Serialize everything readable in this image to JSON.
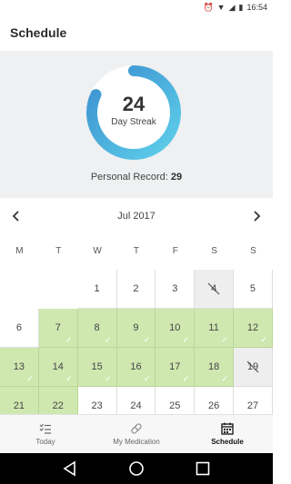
{
  "status": {
    "time": "16:54"
  },
  "app_bar": {
    "title": "Schedule"
  },
  "streak": {
    "value": "24",
    "label": "Day Streak",
    "ring_progress": 0.82,
    "record_label": "Personal Record:",
    "record_value": "29"
  },
  "calendar": {
    "month_label": "Jul 2017",
    "weekdays": [
      "M",
      "T",
      "W",
      "T",
      "F",
      "S",
      "S"
    ],
    "rows": [
      [
        {
          "day": "",
          "state": "empty"
        },
        {
          "day": "",
          "state": "empty"
        },
        {
          "day": "1",
          "state": "none"
        },
        {
          "day": "2",
          "state": "none"
        },
        {
          "day": "3",
          "state": "none"
        },
        {
          "day": "4",
          "state": "skipped"
        },
        {
          "day": "5",
          "state": "none"
        }
      ],
      [
        {
          "day": "6",
          "state": "none"
        },
        {
          "day": "7",
          "state": "done"
        },
        {
          "day": "8",
          "state": "done"
        },
        {
          "day": "9",
          "state": "done"
        },
        {
          "day": "10",
          "state": "done"
        },
        {
          "day": "11",
          "state": "done"
        },
        {
          "day": "12",
          "state": "done"
        }
      ],
      [
        {
          "day": "13",
          "state": "done"
        },
        {
          "day": "14",
          "state": "done"
        },
        {
          "day": "15",
          "state": "done"
        },
        {
          "day": "16",
          "state": "done"
        },
        {
          "day": "17",
          "state": "done"
        },
        {
          "day": "18",
          "state": "done"
        },
        {
          "day": "19",
          "state": "skipped"
        }
      ],
      [
        {
          "day": "21",
          "state": "done"
        },
        {
          "day": "22",
          "state": "done"
        },
        {
          "day": "23",
          "state": "none"
        },
        {
          "day": "24",
          "state": "none"
        },
        {
          "day": "25",
          "state": "none"
        },
        {
          "day": "26",
          "state": "none"
        },
        {
          "day": "27",
          "state": "none"
        }
      ]
    ]
  },
  "tabs": [
    {
      "label": "Today",
      "icon": "checklist-icon",
      "active": false
    },
    {
      "label": "My Medication",
      "icon": "pill-icon",
      "active": false
    },
    {
      "label": "Schedule",
      "icon": "calendar-icon",
      "active": true
    }
  ],
  "colors": {
    "ring_start": "#4fc3e8",
    "ring_end": "#3a8fd0",
    "done_cell": "#cfe8b0",
    "skipped_cell": "#eeeeee",
    "panel_bg": "#eef0f1"
  }
}
